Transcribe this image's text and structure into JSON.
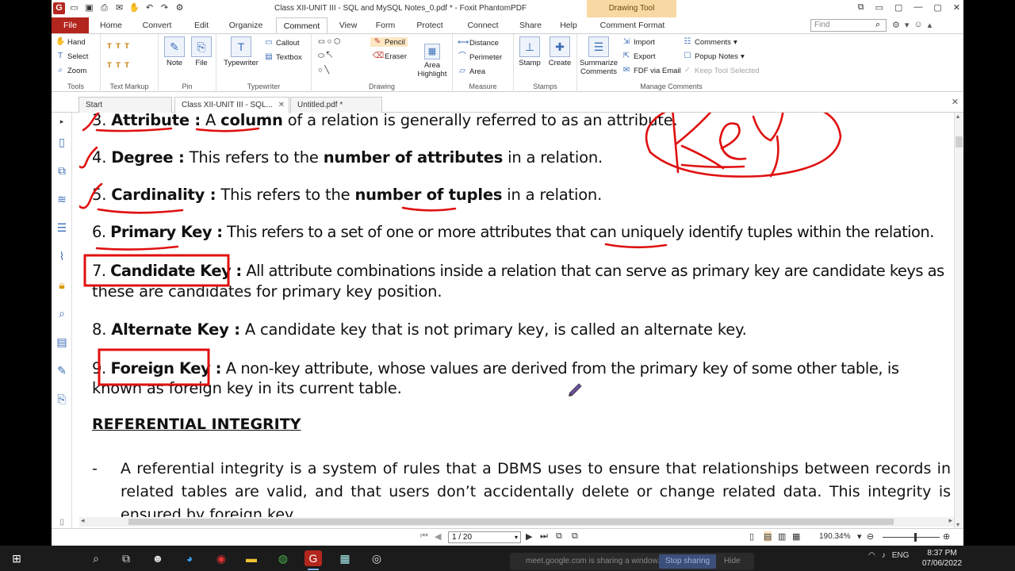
{
  "window": {
    "title": "Class XII-UNIT III - SQL and MySQL Notes_0.pdf * - Foxit PhantomPDF",
    "context_tab": "Drawing Tool",
    "app_glyph": "G"
  },
  "menu": {
    "tabs": [
      "File",
      "Home",
      "Convert",
      "Edit",
      "Organize",
      "Comment",
      "View",
      "Form",
      "Protect",
      "Connect",
      "Share",
      "Help",
      "Comment Format"
    ],
    "active": "Comment",
    "find_placeholder": "Find"
  },
  "ribbon": {
    "tools": {
      "hand": "Hand",
      "select": "Select",
      "zoom": "Zoom",
      "label": "Tools"
    },
    "text_markup": {
      "label": "Text Markup"
    },
    "pin": {
      "note": "Note",
      "file": "File",
      "label": "Pin"
    },
    "typewriter": {
      "typewriter": "Typewriter",
      "callout": "Callout",
      "textbox": "Textbox",
      "label": "Typewriter"
    },
    "drawing": {
      "pencil": "Pencil",
      "eraser": "Eraser",
      "area_highlight_1": "Area",
      "area_highlight_2": "Highlight",
      "label": "Drawing"
    },
    "measure": {
      "distance": "Distance",
      "perimeter": "Perimeter",
      "area": "Area",
      "label": "Measure"
    },
    "stamps": {
      "stamp": "Stamp",
      "create": "Create",
      "label": "Stamps"
    },
    "manage": {
      "summarize_1": "Summarize",
      "summarize_2": "Comments",
      "import": "Import",
      "export": "Export",
      "fdf_email": "FDF via Email",
      "comments": "Comments",
      "popup_notes": "Popup Notes",
      "keep_tool": "Keep Tool Selected",
      "label": "Manage Comments"
    }
  },
  "doc_tabs": [
    "Start",
    "Class XII-UNIT III - SQL...",
    "Untitled.pdf *"
  ],
  "document": {
    "items": [
      {
        "num": "3.",
        "term": "Attribute :",
        "text_a": " A ",
        "bold_b": "column",
        "text_c": " of a relation is generally referred to as an attribute."
      },
      {
        "num": "4.",
        "term": "Degree :",
        "text_a": " This refers to the ",
        "bold_b": "number of attributes",
        "text_c": " in a relation."
      },
      {
        "num": "5.",
        "term": "Cardinality :",
        "text_a": " This refers to the ",
        "bold_b": "number of tuples",
        "text_c": " in a relation."
      },
      {
        "num": "6.",
        "term": "Primary Key :",
        "text_a": " This refers to a set of one or more attributes that can uniquely identify tuples within the relation.",
        "bold_b": "",
        "text_c": ""
      },
      {
        "num": "7.",
        "term": "Candidate Key :",
        "text_a": " All attribute combinations inside a relation that can serve as primary key are candidate keys as",
        "bold_b": "",
        "text_c": ""
      },
      {
        "num": "",
        "term": "",
        "text_a": "these are candidates for primary key position.",
        "bold_b": "",
        "text_c": ""
      },
      {
        "num": "8.",
        "term": "Alternate Key :",
        "text_a": " A candidate key that is not primary key, is called an alternate key.",
        "bold_b": "",
        "text_c": ""
      },
      {
        "num": "9.",
        "term": "Foreign Key :",
        "text_a": " A non-key attribute, whose values are derived from the primary key of some other table, is",
        "bold_b": "",
        "text_c": ""
      },
      {
        "num": "",
        "term": "",
        "text_a": "known as foreign key in its current table.",
        "bold_b": "",
        "text_c": ""
      }
    ],
    "heading": "REFERENTIAL INTEGRITY",
    "bullet": "-",
    "paragraph": "A referential integrity is a system of rules that a DBMS uses to ensure that relationships between records in related tables are valid, and that users don’t accidentally delete or change related data. This integrity is ensured by foreign key."
  },
  "statusbar": {
    "page": "1 / 20",
    "zoom": "190.34%"
  },
  "taskbar": {
    "share_text": "meet.google.com is sharing a window.",
    "stop": "Stop sharing",
    "hide": "Hide",
    "lang": "ENG",
    "time": "8:37 PM",
    "date": "07/06/2022"
  },
  "colors": {
    "accent_red": "#b3261e",
    "ink_red": "#e01010",
    "context_tab": "#f8d9a3"
  }
}
